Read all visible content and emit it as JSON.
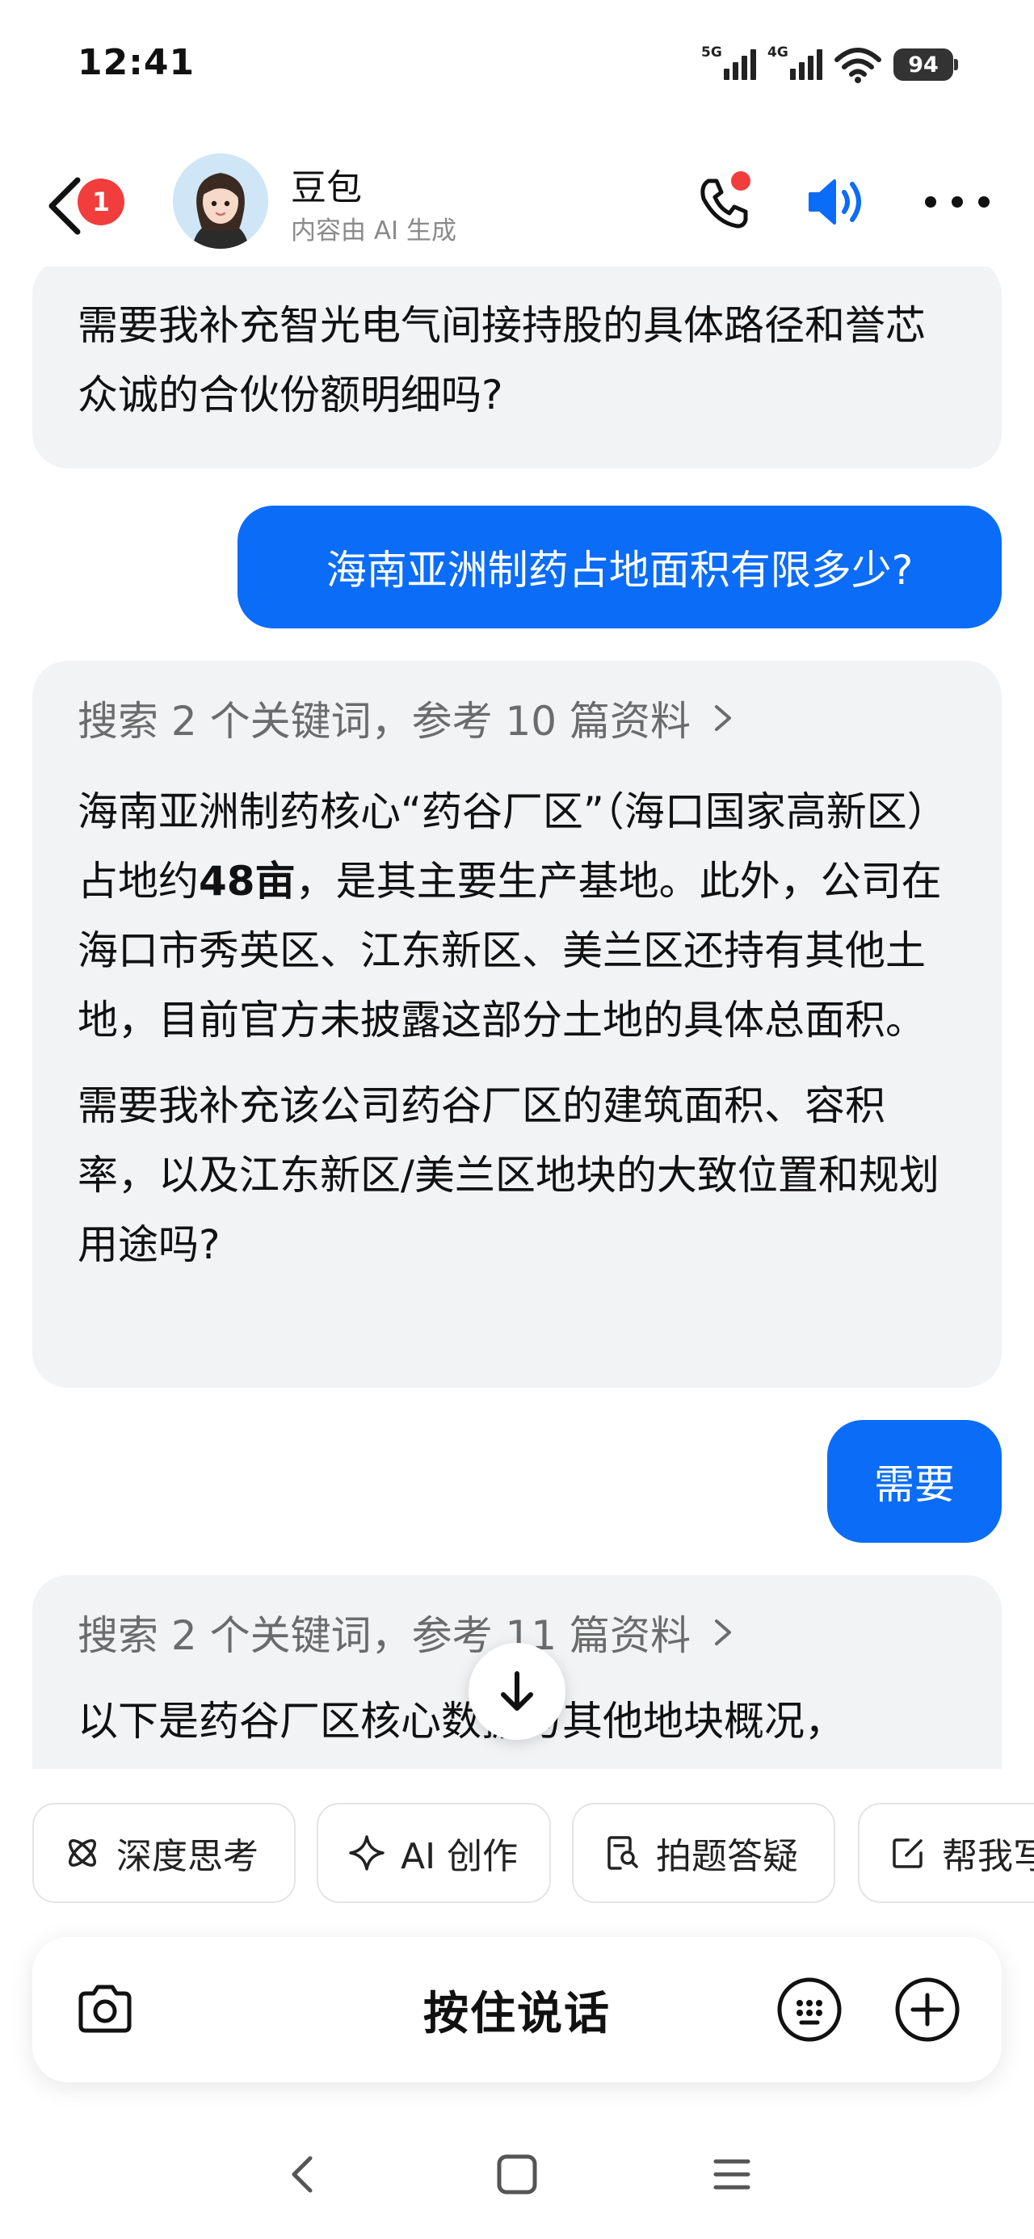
{
  "status_bar": {
    "time": "12:41",
    "network_1": "5G",
    "network_2": "4G",
    "battery": "94"
  },
  "header": {
    "unread_badge": "1",
    "bot_name": "豆包",
    "bot_subtitle": "内容由 AI 生成"
  },
  "messages": {
    "ai_1": {
      "text": "需要我补充智光电气间接持股的具体路径和誉芯众诚的合伙份额明细吗?"
    },
    "user_1": {
      "text": "海南亚洲制药占地面积有限多少?"
    },
    "ai_2": {
      "search_summary": "搜索 2 个关键词，参考 10 篇资料",
      "para1_before": "海南亚洲制药核心“药谷厂区”（海口国家高新区）占地约",
      "para1_bold": "48亩",
      "para1_after": "，是其主要生产基地。此外，公司在海口市秀英区、江东新区、美兰区还持有其他土地，目前官方未披露这部分土地的具体总面积。",
      "para2": "需要我补充该公司药谷厂区的建筑面积、容积率，以及江东新区/美兰区地块的大致位置和规划用途吗?"
    },
    "user_2": {
      "text": "需要"
    },
    "ai_3": {
      "search_summary": "搜索 2 个关键词，参考 11 篇资料",
      "text": "以下是药谷厂区核心数据与其他地块概况，"
    }
  },
  "quick_actions": [
    {
      "label": "深度思考",
      "icon": "atom-icon"
    },
    {
      "label": "AI 创作",
      "icon": "sparkle-icon"
    },
    {
      "label": "拍题答疑",
      "icon": "doc-search-icon"
    },
    {
      "label": "帮我写",
      "icon": "edit-icon"
    }
  ],
  "input_bar": {
    "hold_to_talk": "按住说话"
  },
  "colors": {
    "accent": "#0b6cf7",
    "badge_red": "#f23d3d",
    "bubble_gray": "#f2f3f5"
  }
}
